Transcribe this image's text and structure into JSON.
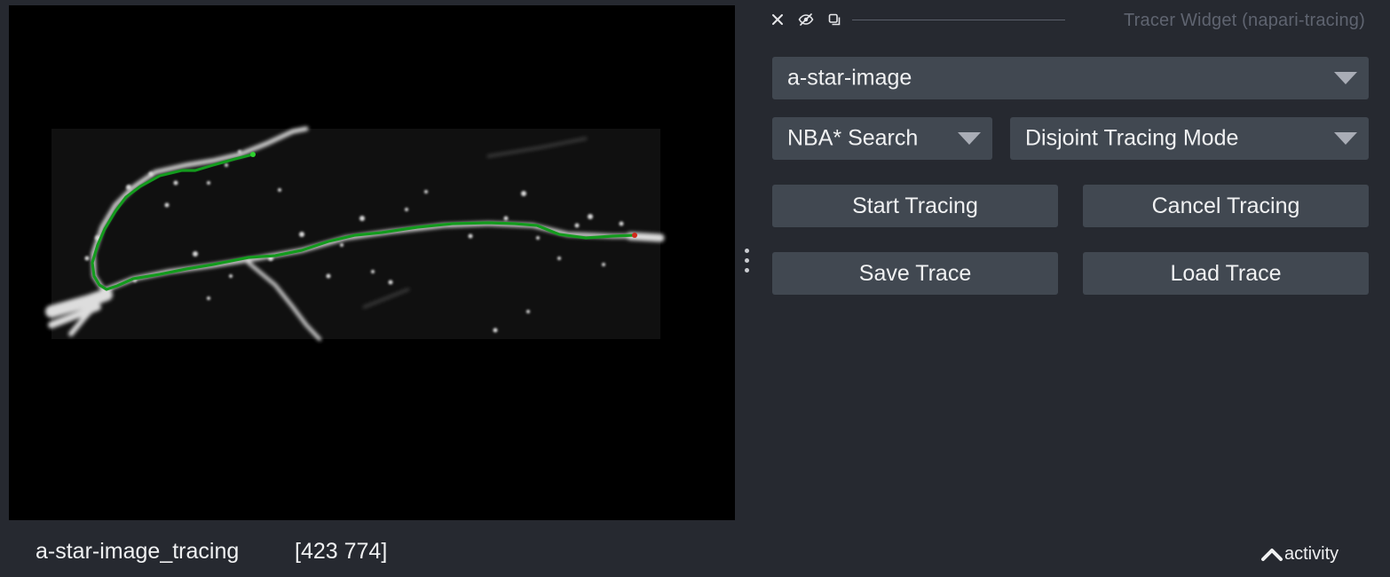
{
  "canvas": {
    "layer_name": "a-star-image_tracing",
    "coordinates": "[423 774]",
    "trace_color": "#139b1d",
    "start_point_color": "#2fd12f",
    "end_point_color": "#d02a1b"
  },
  "dock": {
    "title": "Tracer Widget (napari-tracing)",
    "close_icon": "close-icon",
    "hide_icon": "eye-hidden-icon",
    "float_icon": "float-window-icon"
  },
  "widget": {
    "image_layer": {
      "selected": "a-star-image"
    },
    "search_algorithm": {
      "selected": "NBA* Search"
    },
    "tracing_mode": {
      "selected": "Disjoint Tracing Mode"
    },
    "start_label": "Start Tracing",
    "cancel_label": "Cancel Tracing",
    "save_label": "Save Trace",
    "load_label": "Load Trace"
  },
  "statusbar": {
    "activity_label": "activity",
    "activity_icon": "chevron-up-icon"
  },
  "colors": {
    "background": "#262930",
    "control": "#414851",
    "text": "#f0f1f2",
    "muted": "#5f6470"
  }
}
